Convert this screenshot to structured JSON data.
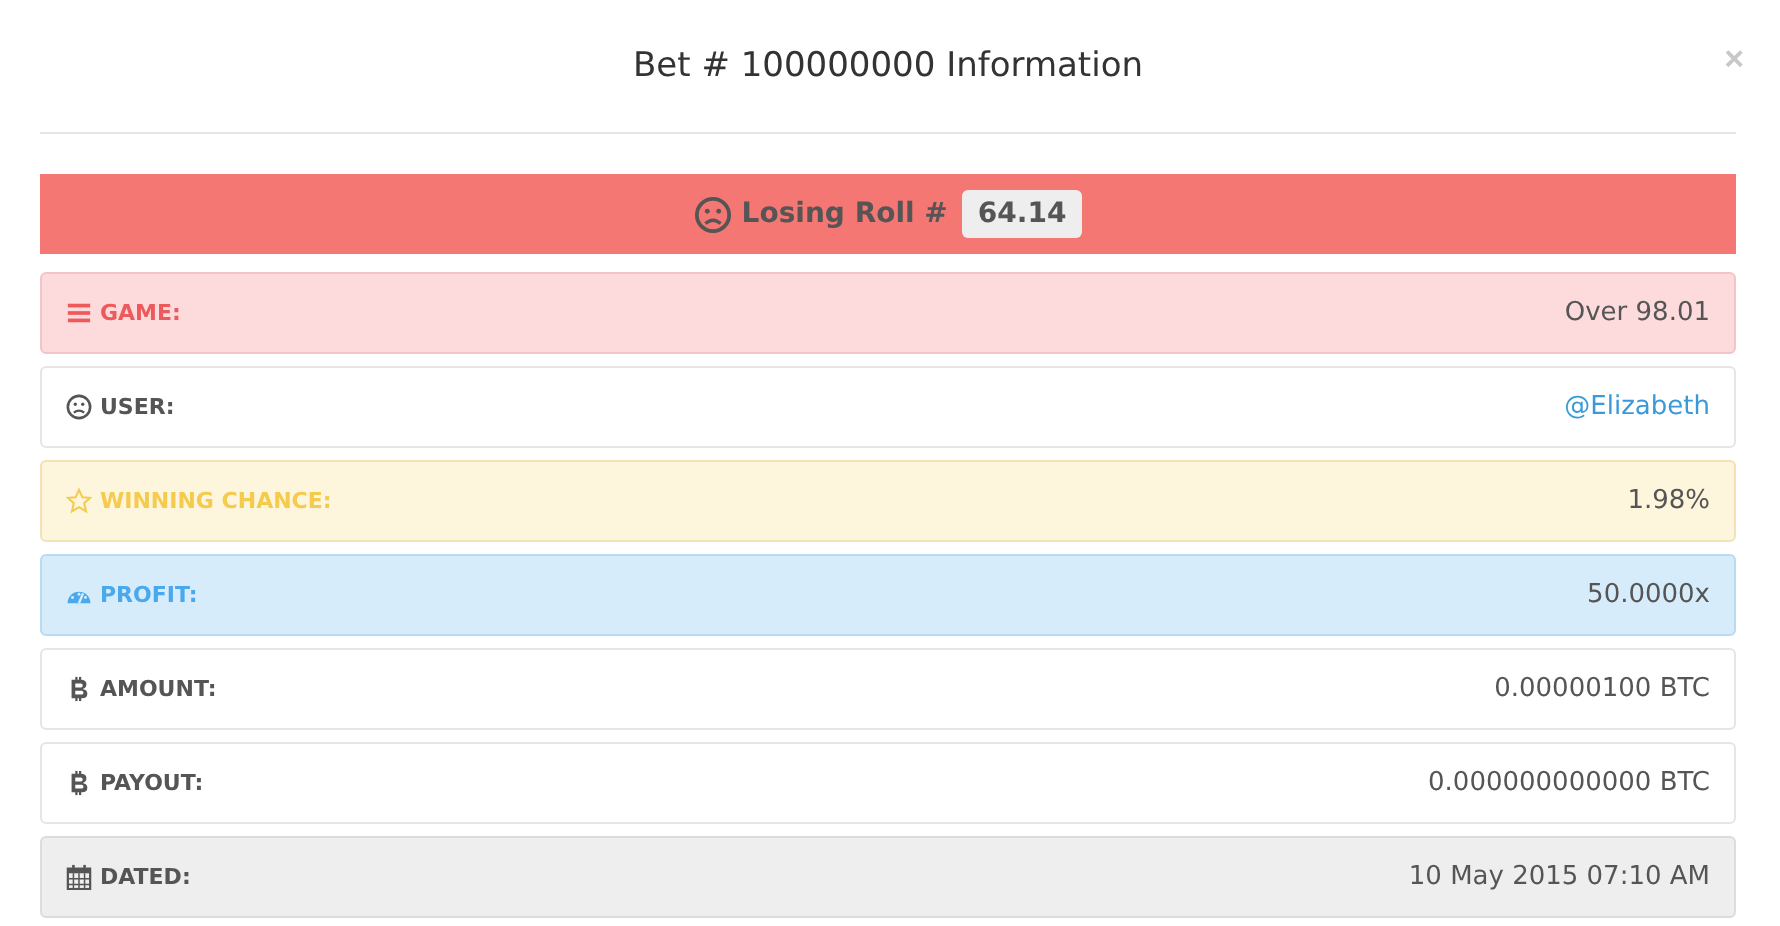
{
  "modal": {
    "title": "Bet # 100000000 Information",
    "close": "×"
  },
  "banner": {
    "label": "Losing Roll #",
    "roll": "64.14"
  },
  "rows": [
    {
      "kind": "danger",
      "label": "GAME:",
      "value": "Over 98.01"
    },
    {
      "kind": "default",
      "label": "USER:",
      "value": "@Elizabeth",
      "link": true
    },
    {
      "kind": "warning",
      "label": "WINNING CHANCE:",
      "value": "1.98%"
    },
    {
      "kind": "info",
      "label": "PROFIT:",
      "value": "50.0000x"
    },
    {
      "kind": "default",
      "label": "AMOUNT:",
      "value": "0.00000100 BTC"
    },
    {
      "kind": "default",
      "label": "PAYOUT:",
      "value": "0.000000000000 BTC"
    },
    {
      "kind": "active",
      "label": "DATED:",
      "value": "10 May 2015 07:10 AM"
    }
  ]
}
